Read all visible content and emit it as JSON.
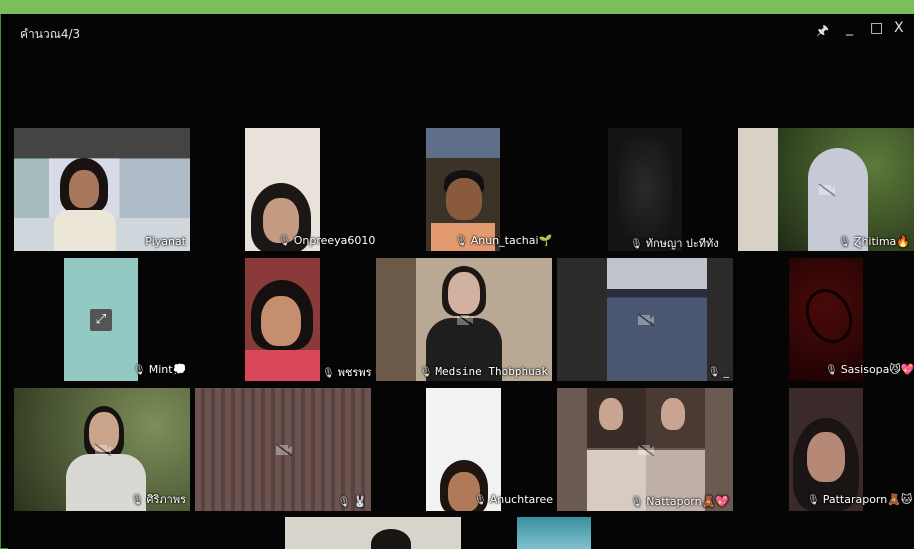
{
  "window": {
    "title": "คำนวณ4/3",
    "pin_icon": "pin-icon",
    "minimize": "_",
    "maximize": "□",
    "close": "X"
  },
  "participants": [
    {
      "name": "Piyanat"
    },
    {
      "name": "Onpreeya6010"
    },
    {
      "name": "Anun_tachai🌱"
    },
    {
      "name": "ทักษญา ปะทีทัง"
    },
    {
      "name": "Ɀhitima🔥"
    },
    {
      "name": "Mint💭"
    },
    {
      "name": "พชรพร"
    },
    {
      "name": "Medsine Thobphuak"
    },
    {
      "name": "_"
    },
    {
      "name": "Sasisopa😼💖"
    },
    {
      "name": "ศิริภาพร"
    },
    {
      "name": "🐰"
    },
    {
      "name": "Anuchtaree"
    },
    {
      "name": "Nattaporn🧸💖"
    },
    {
      "name": "Pattaraporn🧸🐱"
    }
  ],
  "colors": {
    "border": "#3f8f3a",
    "accent": "#7bbf5a",
    "background": "#050505"
  }
}
